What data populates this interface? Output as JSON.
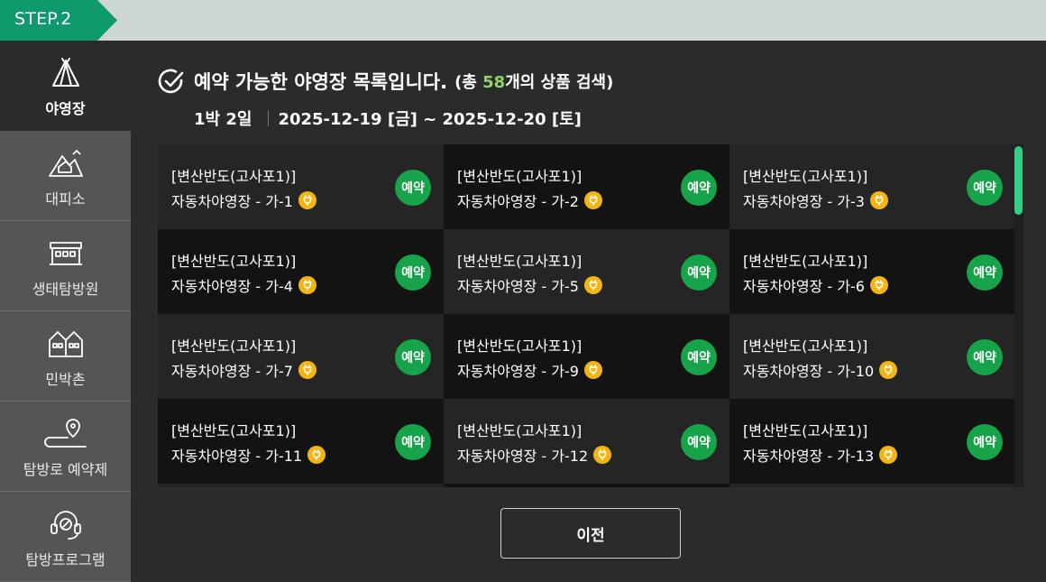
{
  "step": {
    "label": "STEP.2"
  },
  "sidebar": {
    "items": [
      {
        "label": "야영장",
        "icon": "tent-icon",
        "active": true
      },
      {
        "label": "대피소",
        "icon": "shelter-icon",
        "active": false
      },
      {
        "label": "생태탐방원",
        "icon": "building-icon",
        "active": false
      },
      {
        "label": "민박촌",
        "icon": "houses-icon",
        "active": false
      },
      {
        "label": "탐방로 예약제",
        "icon": "trail-pin-icon",
        "active": false
      },
      {
        "label": "탐방프로그램",
        "icon": "guide-headset-icon",
        "active": false
      }
    ]
  },
  "header": {
    "title": "예약 가능한 야영장 목록입니다.",
    "count_prefix": "(총 ",
    "count": "58",
    "count_suffix": "개의 상품 검색)",
    "nights": "1박 2일",
    "date_range": "2025-12-19 [금] ~ 2025-12-20 [토]"
  },
  "sites": [
    {
      "area": "[변산반도(고사포1)]",
      "name": "자동차야영장 - 가-1",
      "button": "예약"
    },
    {
      "area": "[변산반도(고사포1)]",
      "name": "자동차야영장 - 가-2",
      "button": "예약"
    },
    {
      "area": "[변산반도(고사포1)]",
      "name": "자동차야영장 - 가-3",
      "button": "예약"
    },
    {
      "area": "[변산반도(고사포1)]",
      "name": "자동차야영장 - 가-4",
      "button": "예약"
    },
    {
      "area": "[변산반도(고사포1)]",
      "name": "자동차야영장 - 가-5",
      "button": "예약"
    },
    {
      "area": "[변산반도(고사포1)]",
      "name": "자동차야영장 - 가-6",
      "button": "예약"
    },
    {
      "area": "[변산반도(고사포1)]",
      "name": "자동차야영장 - 가-7",
      "button": "예약"
    },
    {
      "area": "[변산반도(고사포1)]",
      "name": "자동차야영장 - 가-9",
      "button": "예약"
    },
    {
      "area": "[변산반도(고사포1)]",
      "name": "자동차야영장 - 가-10",
      "button": "예약"
    },
    {
      "area": "[변산반도(고사포1)]",
      "name": "자동차야영장 - 가-11",
      "button": "예약"
    },
    {
      "area": "[변산반도(고사포1)]",
      "name": "자동차야영장 - 가-12",
      "button": "예약"
    },
    {
      "area": "[변산반도(고사포1)]",
      "name": "자동차야영장 - 가-13",
      "button": "예약"
    }
  ],
  "footer": {
    "prev_label": "이전"
  },
  "colors": {
    "step_badge": "#0f9a6e",
    "book_button": "#16a34a",
    "count_highlight": "#8fd46a",
    "electric_badge": "#f2b514",
    "scroll_thumb": "#2fd08a"
  }
}
